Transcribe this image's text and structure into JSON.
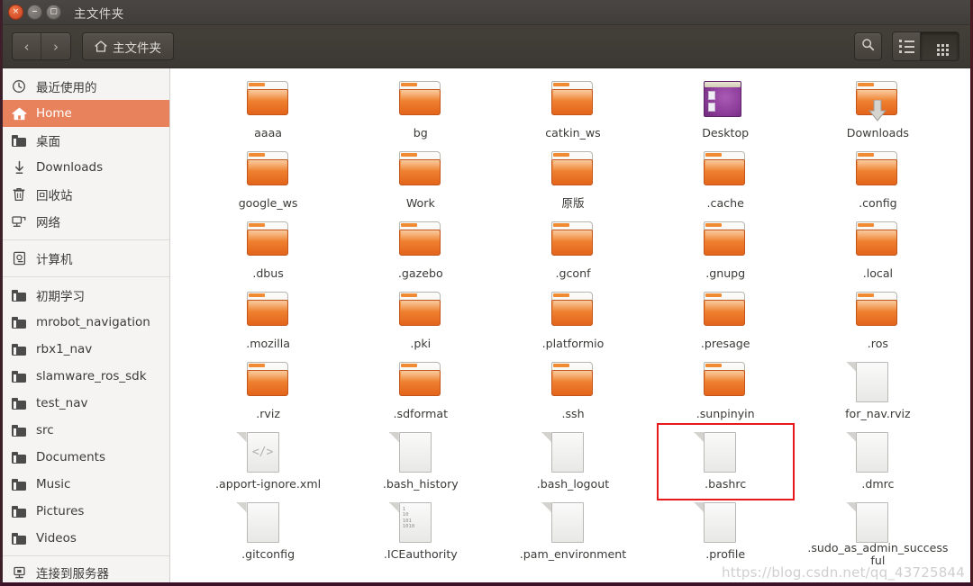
{
  "window": {
    "title": "主文件夹",
    "close_label": "×",
    "minimize_label": "–",
    "maximize_label": "▢"
  },
  "toolbar": {
    "back_label": "‹",
    "forward_label": "›",
    "breadcrumb_label": "主文件夹",
    "search_label": "search-icon",
    "view_list_label": "list-view",
    "view_grid_label": "grid-view",
    "active_view": "grid"
  },
  "sidebar": {
    "groups": [
      {
        "items": [
          {
            "label": "最近使用的",
            "icon": "clock-icon",
            "selected": false
          },
          {
            "label": "Home",
            "icon": "home-icon",
            "selected": true
          },
          {
            "label": "桌面",
            "icon": "folder-icon",
            "selected": false
          },
          {
            "label": "Downloads",
            "icon": "download-icon",
            "selected": false
          },
          {
            "label": "回收站",
            "icon": "trash-icon",
            "selected": false
          },
          {
            "label": "网络",
            "icon": "network-icon",
            "selected": false
          }
        ]
      },
      {
        "items": [
          {
            "label": "计算机",
            "icon": "computer-icon",
            "selected": false
          }
        ]
      },
      {
        "items": [
          {
            "label": "初期学习",
            "icon": "folder-icon",
            "selected": false
          },
          {
            "label": "mrobot_navigation",
            "icon": "folder-icon",
            "selected": false
          },
          {
            "label": "rbx1_nav",
            "icon": "folder-icon",
            "selected": false
          },
          {
            "label": "slamware_ros_sdk",
            "icon": "folder-icon",
            "selected": false
          },
          {
            "label": "test_nav",
            "icon": "folder-icon",
            "selected": false
          },
          {
            "label": "src",
            "icon": "folder-icon",
            "selected": false
          },
          {
            "label": "Documents",
            "icon": "folder-icon",
            "selected": false
          },
          {
            "label": "Music",
            "icon": "folder-icon",
            "selected": false
          },
          {
            "label": "Pictures",
            "icon": "folder-icon",
            "selected": false
          },
          {
            "label": "Videos",
            "icon": "folder-icon",
            "selected": false
          }
        ]
      }
    ],
    "bottom": {
      "label": "连接到服务器",
      "icon": "server-icon"
    }
  },
  "files": {
    "selection_color": "#e8191b",
    "items": [
      {
        "name": "aaaa",
        "type": "folder",
        "highlighted": false
      },
      {
        "name": "bg",
        "type": "folder",
        "highlighted": false
      },
      {
        "name": "catkin_ws",
        "type": "folder",
        "highlighted": false
      },
      {
        "name": "Desktop",
        "type": "desktop",
        "highlighted": false
      },
      {
        "name": "Downloads",
        "type": "download",
        "highlighted": false
      },
      {
        "name": "google_ws",
        "type": "folder",
        "highlighted": false
      },
      {
        "name": "Work",
        "type": "folder",
        "highlighted": false
      },
      {
        "name": "原版",
        "type": "folder",
        "highlighted": false
      },
      {
        "name": ".cache",
        "type": "folder",
        "highlighted": false
      },
      {
        "name": ".config",
        "type": "folder",
        "highlighted": false
      },
      {
        "name": ".dbus",
        "type": "folder",
        "highlighted": false
      },
      {
        "name": ".gazebo",
        "type": "folder",
        "highlighted": false
      },
      {
        "name": ".gconf",
        "type": "folder",
        "highlighted": false
      },
      {
        "name": ".gnupg",
        "type": "folder",
        "highlighted": false
      },
      {
        "name": ".local",
        "type": "folder",
        "highlighted": false
      },
      {
        "name": ".mozilla",
        "type": "folder",
        "highlighted": false
      },
      {
        "name": ".pki",
        "type": "folder",
        "highlighted": false
      },
      {
        "name": ".platformio",
        "type": "folder",
        "highlighted": false
      },
      {
        "name": ".presage",
        "type": "folder",
        "highlighted": false
      },
      {
        "name": ".ros",
        "type": "folder",
        "highlighted": false
      },
      {
        "name": ".rviz",
        "type": "folder",
        "highlighted": false
      },
      {
        "name": ".sdformat",
        "type": "folder",
        "highlighted": false
      },
      {
        "name": ".ssh",
        "type": "folder",
        "highlighted": false
      },
      {
        "name": ".sunpinyin",
        "type": "folder",
        "highlighted": false
      },
      {
        "name": "for_nav.rviz",
        "type": "document",
        "highlighted": false
      },
      {
        "name": ".apport-ignore.xml",
        "type": "code",
        "highlighted": false
      },
      {
        "name": ".bash_history",
        "type": "document",
        "highlighted": false
      },
      {
        "name": ".bash_logout",
        "type": "document",
        "highlighted": false
      },
      {
        "name": ".bashrc",
        "type": "document",
        "highlighted": true
      },
      {
        "name": ".dmrc",
        "type": "document",
        "highlighted": false
      },
      {
        "name": ".gitconfig",
        "type": "document",
        "highlighted": false
      },
      {
        "name": ".ICEauthority",
        "type": "binary",
        "highlighted": false
      },
      {
        "name": ".pam_environment",
        "type": "document",
        "highlighted": false
      },
      {
        "name": ".profile",
        "type": "document",
        "highlighted": false
      },
      {
        "name": ".sudo_as_admin_successful",
        "type": "document",
        "highlighted": false
      }
    ]
  },
  "watermark": {
    "text": "https://blog.csdn.net/qq_43725844"
  }
}
